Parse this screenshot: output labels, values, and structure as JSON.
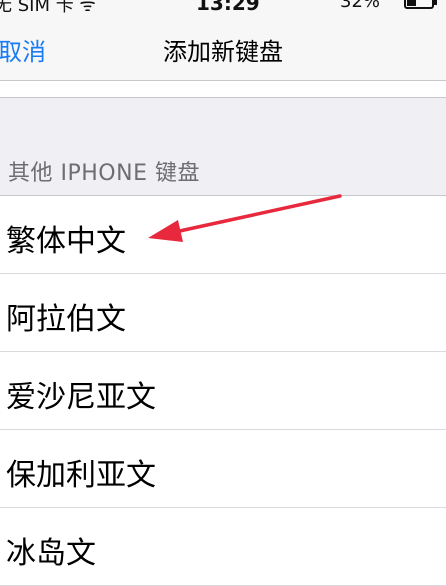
{
  "status_bar": {
    "carrier": "无 SIM 卡 ᯤ",
    "time": "13:29",
    "battery": "32%"
  },
  "nav": {
    "cancel_label": "取消",
    "title": "添加新键盘"
  },
  "section": {
    "header": "其他 IPHONE 键盘"
  },
  "keyboards": [
    {
      "label": "繁体中文"
    },
    {
      "label": "阿拉伯文"
    },
    {
      "label": "爱沙尼亚文"
    },
    {
      "label": "保加利亚文"
    },
    {
      "label": "冰岛文"
    }
  ],
  "colors": {
    "accent": "#1a7cf5",
    "annotation_arrow": "#e8283c"
  },
  "annotation": {
    "icon": "red-arrow-icon"
  }
}
